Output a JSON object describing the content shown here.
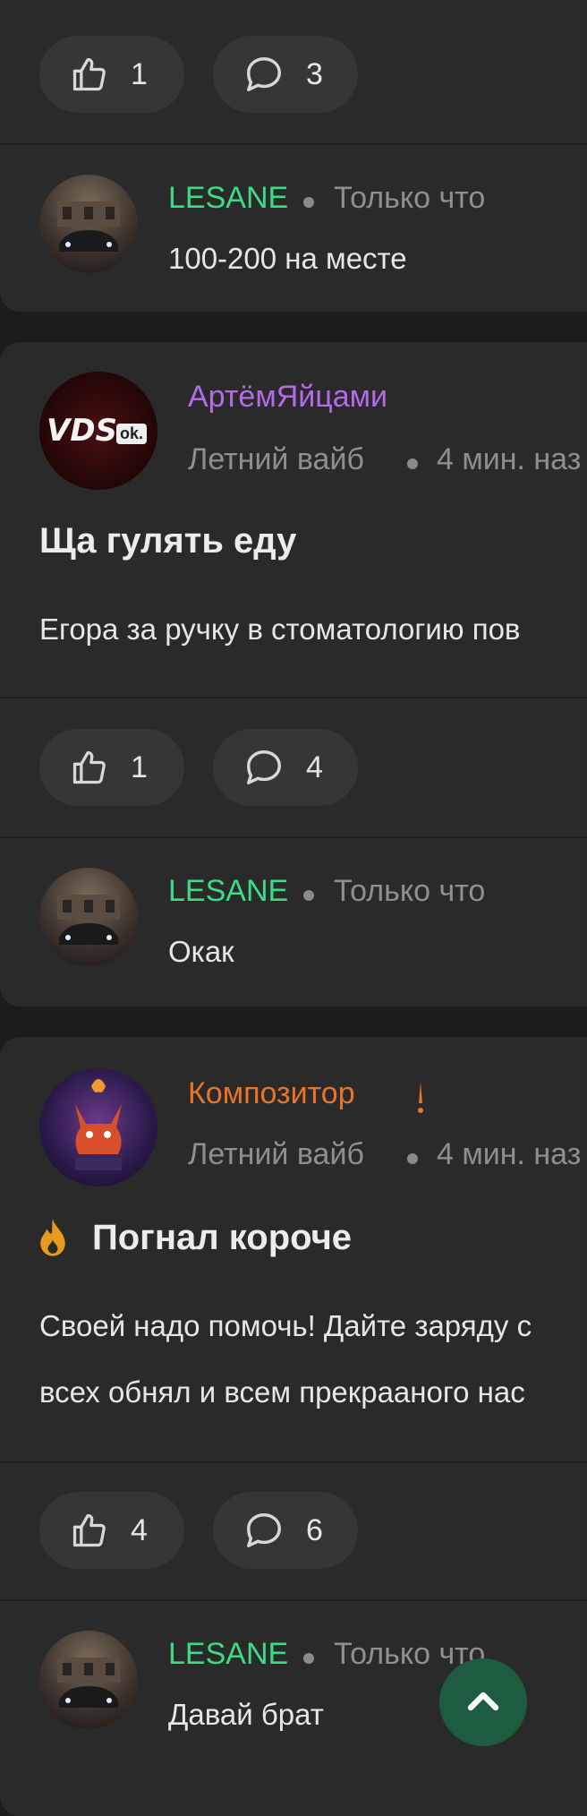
{
  "post1": {
    "reactions": {
      "likes": "1",
      "comments": "3"
    },
    "comment": {
      "author": "LESANE",
      "time": "Только что",
      "text": "100-200 на месте"
    }
  },
  "post2": {
    "author": "АртёмЯйцами",
    "community": "Летний вайб",
    "time": "4 мин. наз",
    "avatar_text": "VDS",
    "avatar_badge": "ok.",
    "title": "Ща гулять еду",
    "body": "Егора за ручку в стоматологию пов",
    "reactions": {
      "likes": "1",
      "comments": "4"
    },
    "comment": {
      "author": "LESANE",
      "time": "Только что",
      "text": "Окак"
    }
  },
  "post3": {
    "author": "Композитор",
    "community": "Летний вайб",
    "time": "4 мин. наз",
    "title": "Погнал короче",
    "body_lines": [
      "Своей надо помочь! Дайте заряду с",
      "всех обнял и всем прекрааного нас"
    ],
    "reactions": {
      "likes": "4",
      "comments": "6"
    },
    "comment": {
      "author": "LESANE",
      "time": "Только что",
      "text": "Давай брат"
    }
  },
  "colors": {
    "accent_green": "#3ddc84",
    "author_purple": "#b36be8",
    "author_orange": "#e8742a",
    "fab": "#1e5c3f"
  },
  "icons": [
    "thumbs-up-icon",
    "comment-bubble-icon",
    "fire-icon",
    "chevron-up-icon",
    "exclamation-icon"
  ]
}
